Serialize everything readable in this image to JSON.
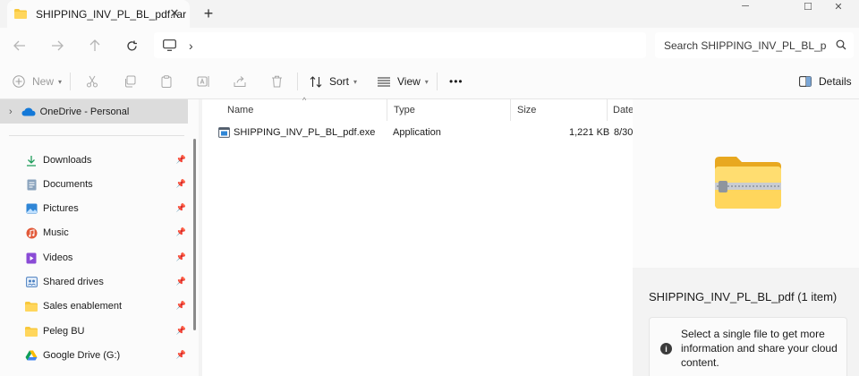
{
  "tab": {
    "title": "SHIPPING_INV_PL_BL_pdf.rar"
  },
  "window_controls": {
    "minimize": "─",
    "maximize": "☐",
    "close": "✕"
  },
  "address": {
    "separator": "›"
  },
  "search": {
    "placeholder": "Search SHIPPING_INV_PL_BL_pdf."
  },
  "toolbar": {
    "new_label": "New",
    "sort_label": "Sort",
    "view_label": "View",
    "more_label": "•••",
    "details_label": "Details"
  },
  "sidebar": {
    "onedrive_label": "OneDrive - Personal",
    "items": [
      {
        "label": "Downloads",
        "icon": "download-icon"
      },
      {
        "label": "Documents",
        "icon": "documents-icon"
      },
      {
        "label": "Pictures",
        "icon": "pictures-icon"
      },
      {
        "label": "Music",
        "icon": "music-icon"
      },
      {
        "label": "Videos",
        "icon": "videos-icon"
      },
      {
        "label": "Shared drives",
        "icon": "shared-drives-icon"
      },
      {
        "label": "Sales enablement",
        "icon": "folder-icon"
      },
      {
        "label": "Peleg BU",
        "icon": "folder-icon"
      },
      {
        "label": "Google Drive (G:)",
        "icon": "google-drive-icon"
      }
    ]
  },
  "filelist": {
    "columns": [
      "Name",
      "Type",
      "Size",
      "Date"
    ],
    "rows": [
      {
        "name": "SHIPPING_INV_PL_BL_pdf.exe",
        "type": "Application",
        "size": "1,221 KB",
        "date": "8/30"
      }
    ]
  },
  "details": {
    "title": "SHIPPING_INV_PL_BL_pdf (1 item)",
    "message": "Select a single file to get more information and share your cloud content."
  },
  "colors": {
    "accent": "#0067c0",
    "folder_yellow": "#f8c83c",
    "selection": "#dcdcdc"
  }
}
